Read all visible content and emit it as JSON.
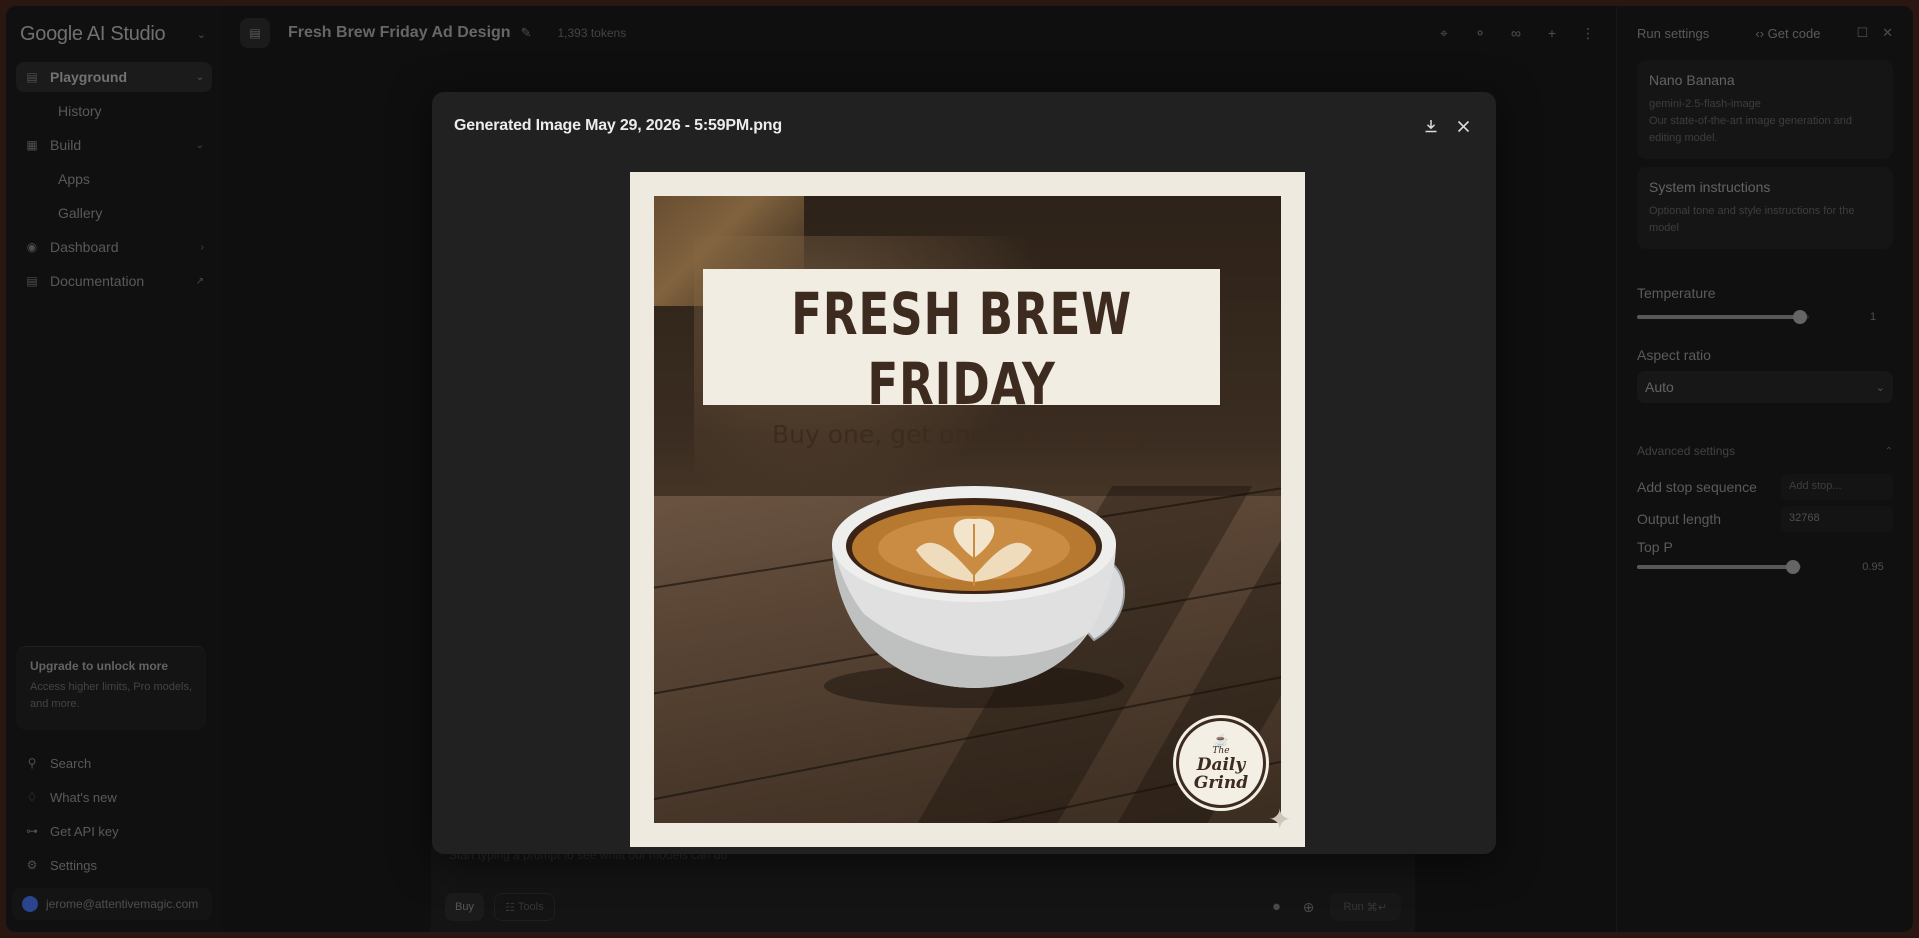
{
  "sidebar": {
    "brand": "Google AI Studio",
    "nav": [
      {
        "label": "Playground",
        "icon": "playground-icon",
        "active": true
      },
      {
        "label": "History",
        "sub": true
      },
      {
        "label": "Build",
        "icon": "build-icon"
      },
      {
        "label": "Apps",
        "sub": true
      },
      {
        "label": "Gallery",
        "sub": true
      },
      {
        "label": "Dashboard",
        "icon": "dashboard-icon"
      },
      {
        "label": "Documentation",
        "icon": "documentation-icon"
      }
    ],
    "upgrade": {
      "title": "Upgrade to unlock more",
      "desc": "Access higher limits, Pro models, and more."
    },
    "bottom": [
      "Search",
      "What's new",
      "Get API key",
      "Settings"
    ],
    "account": "jerome@attentivemagic.com"
  },
  "header": {
    "title": "Fresh Brew Friday Ad Design",
    "tokens": "1,393 tokens"
  },
  "right": {
    "run_settings": "Run settings",
    "get_code": "Get code",
    "model": {
      "name": "Nano Banana",
      "id": "gemini-2.5-flash-image",
      "desc": "Our state-of-the-art image generation and editing model."
    },
    "system": {
      "title": "System instructions",
      "desc": "Optional tone and style instructions for the model"
    },
    "temperature": {
      "label": "Temperature",
      "value": "1",
      "fraction": 0.95
    },
    "aspect": {
      "label": "Aspect ratio",
      "value": "Auto"
    },
    "advanced": "Advanced settings",
    "stop": {
      "label": "Add stop sequence",
      "placeholder": "Add stop..."
    },
    "output": {
      "label": "Output length",
      "value": "32768"
    },
    "topp": {
      "label": "Top P",
      "value": "0.95",
      "fraction": 0.95
    }
  },
  "composer": {
    "placeholder": "Start typing a prompt to see what our models can do",
    "chip1": "Buy",
    "chip2": "Tools",
    "run": "Run"
  },
  "modal": {
    "title": "Generated Image May 29, 2026 - 5:59PM.png",
    "image": {
      "headline": "FRESH BREW FRIDAY",
      "subline": "Buy one, get one free - all day",
      "badge_small": "The",
      "badge_line1": "Daily",
      "badge_line2": "Grind"
    }
  }
}
